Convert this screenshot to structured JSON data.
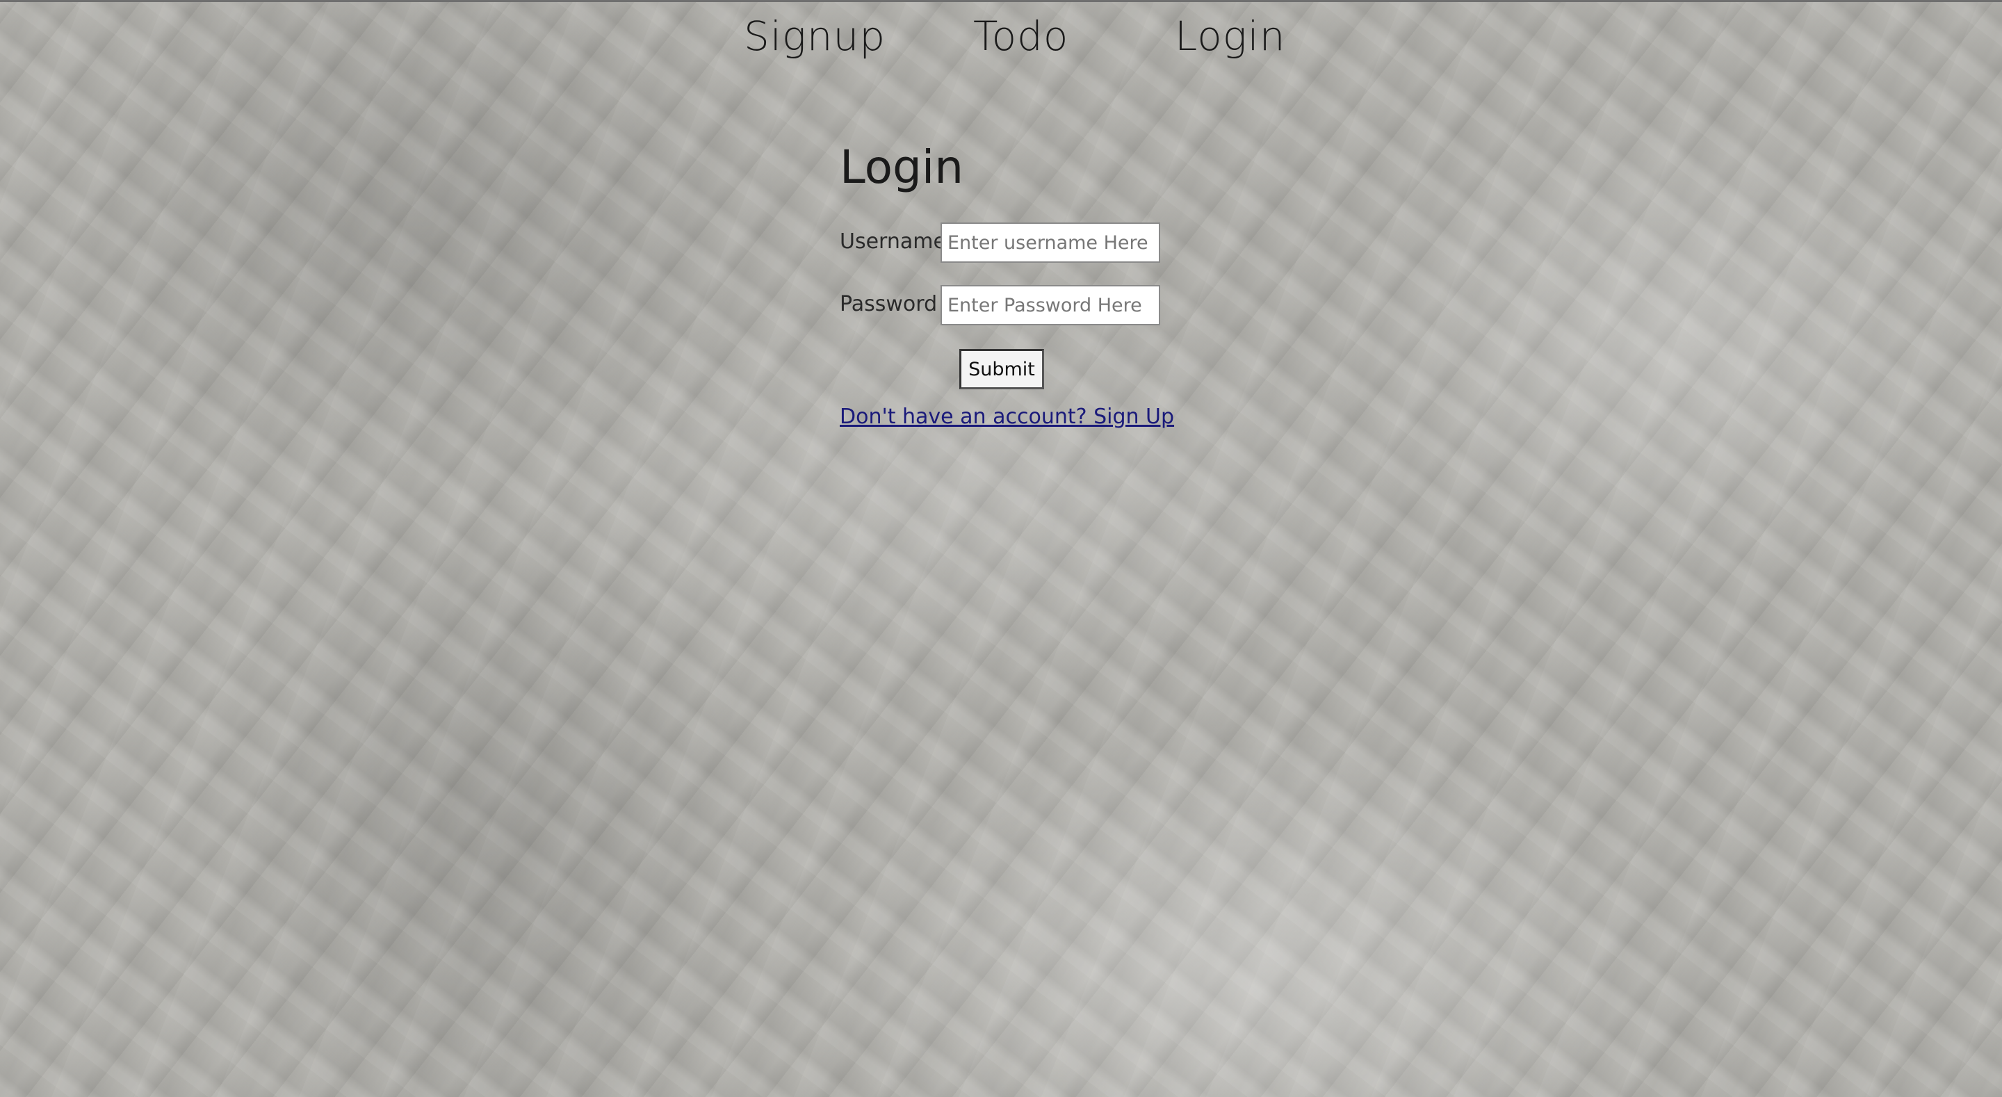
{
  "nav": {
    "items": [
      {
        "label": "Signup"
      },
      {
        "label": "Todo"
      },
      {
        "label": "Login"
      }
    ]
  },
  "login": {
    "title": "Login",
    "username_label": "Username",
    "username_placeholder": "Enter username Here",
    "username_value": "",
    "password_label": "Password",
    "password_placeholder": "Enter Password Here",
    "password_value": "",
    "submit_label": "Submit",
    "signup_link": "Don't have an account? Sign Up"
  },
  "colors": {
    "background": "#b3b2ad",
    "link": "#1a1a7a",
    "text": "#1a1a1a"
  }
}
